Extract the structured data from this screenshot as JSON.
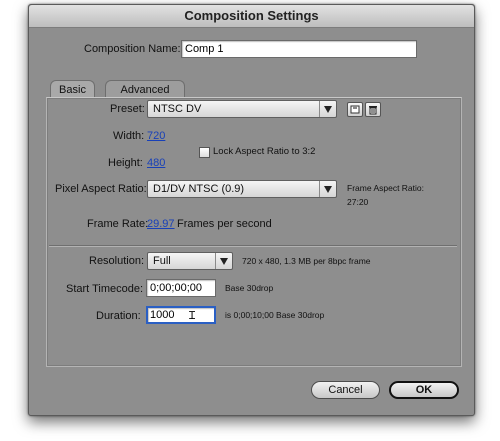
{
  "dialog": {
    "title": "Composition Settings"
  },
  "comp_name": {
    "label": "Composition Name:",
    "value": "Comp 1"
  },
  "tabs": [
    {
      "label": "Basic"
    },
    {
      "label": "Advanced"
    }
  ],
  "preset": {
    "label": "Preset:",
    "value": "NTSC DV"
  },
  "width": {
    "label": "Width:",
    "value": "720"
  },
  "height": {
    "label": "Height:",
    "value": "480"
  },
  "lock_aspect": {
    "label": "Lock Aspect Ratio to 3:2",
    "checked": false
  },
  "pixel_aspect": {
    "label": "Pixel Aspect Ratio:",
    "value": "D1/DV NTSC (0.9)"
  },
  "frame_aspect": {
    "line1": "Frame Aspect Ratio:",
    "line2": "27:20"
  },
  "frame_rate": {
    "label": "Frame Rate:",
    "value": "29.97",
    "suffix": "Frames per second"
  },
  "resolution": {
    "label": "Resolution:",
    "value": "Full",
    "info": "720 x 480, 1.3 MB per 8bpc frame"
  },
  "start_timecode": {
    "label": "Start Timecode:",
    "value": "0;00;00;00",
    "note": "Base 30drop"
  },
  "duration": {
    "label": "Duration:",
    "value": "1000",
    "note": "is 0;00;10;00  Base 30drop"
  },
  "buttons": {
    "cancel": "Cancel",
    "ok": "OK"
  }
}
